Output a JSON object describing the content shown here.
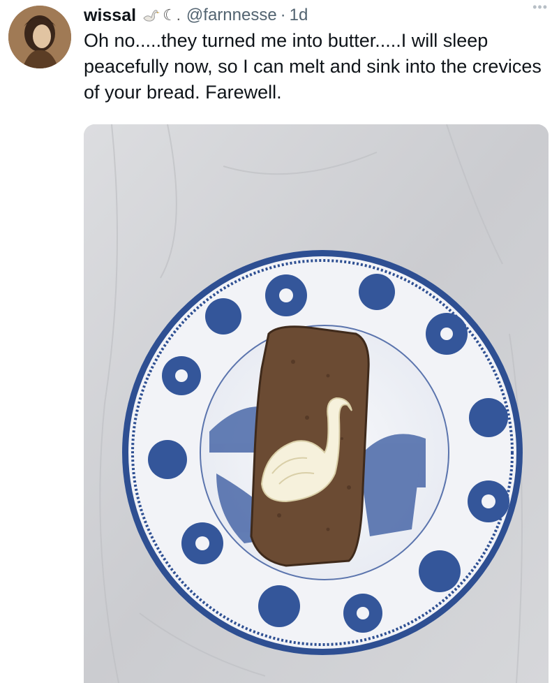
{
  "tweet": {
    "display_name": "wissal",
    "name_emojis": [
      "swan-emoji",
      "crescent-moon-emoji"
    ],
    "moon_glyph": "☾.",
    "handle": "@farnnesse",
    "separator": "·",
    "time": "1d",
    "more_label": "•••",
    "text": "Oh no.....they turned me into butter.....I will sleep peacefully now, so I can melt  and sink into the crevices of your bread. Farewell."
  },
  "media": {
    "icon": "photo-of-butter-swan-on-bread-on-blue-willow-plate",
    "colors": {
      "tablecloth": "#cfd0d2",
      "plate_blue": "#2e4f92",
      "plate_white": "#f4f5f8",
      "bread": "#6b4b33",
      "butter": "#f6f1dc"
    }
  }
}
